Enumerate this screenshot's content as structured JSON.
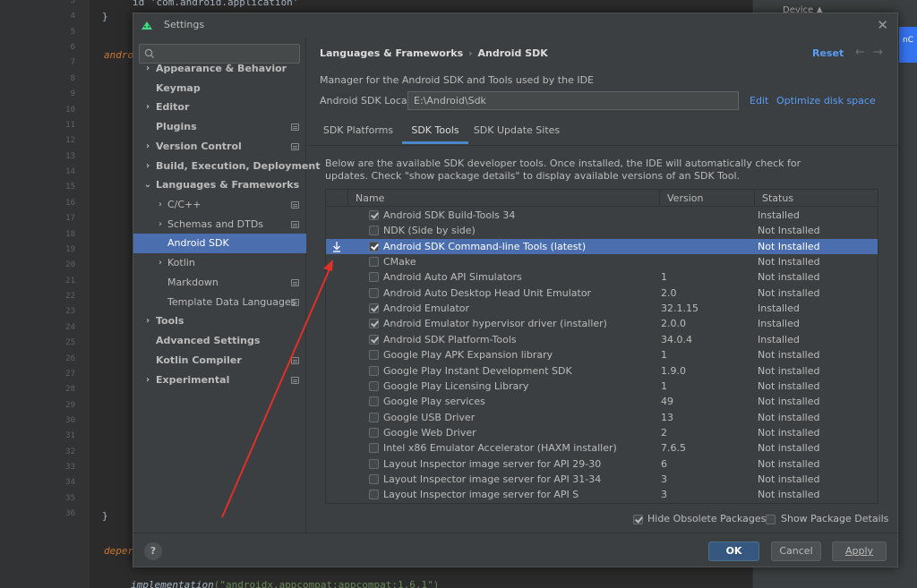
{
  "editor": {
    "line_numbers": [
      "3",
      "4",
      "5",
      "6",
      "7",
      "8",
      "9",
      "10",
      "11",
      "12",
      "13",
      "14",
      "15",
      "16",
      "17",
      "18",
      "19",
      "20",
      "21",
      "22",
      "23",
      "24",
      "25",
      "26",
      "27",
      "28",
      "29",
      "30",
      "31",
      "32",
      "33",
      "34",
      "35",
      "36"
    ],
    "top_code": "id 'com.android.application'",
    "fragment_android": "andro",
    "fragment_deps": "deper",
    "fragment_brace": "}",
    "bottom_code_fn": "implementation",
    "bottom_code_str": "(\"androidx.appcompat:appcompat:1.6.1\")"
  },
  "right_panel": {
    "device_label": "Device ▲",
    "edge_label": "nC"
  },
  "dialog": {
    "title": "Settings",
    "close_glyph": "✕"
  },
  "nav": {
    "search_placeholder": "",
    "items": [
      {
        "label": "Appearance & Behavior",
        "arrow": "›",
        "bold": true,
        "badge": false
      },
      {
        "label": "Keymap",
        "arrow": "",
        "bold": true,
        "badge": false
      },
      {
        "label": "Editor",
        "arrow": "›",
        "bold": true,
        "badge": false
      },
      {
        "label": "Plugins",
        "arrow": "",
        "bold": true,
        "badge": true
      },
      {
        "label": "Version Control",
        "arrow": "›",
        "bold": true,
        "badge": true
      },
      {
        "label": "Build, Execution, Deployment",
        "arrow": "›",
        "bold": true,
        "badge": false
      },
      {
        "label": "Languages & Frameworks",
        "arrow": "⌄",
        "bold": true,
        "badge": false
      },
      {
        "label": "C/C++",
        "arrow": "›",
        "bold": false,
        "badge": true
      },
      {
        "label": "Schemas and DTDs",
        "arrow": "›",
        "bold": false,
        "badge": true
      },
      {
        "label": "Android SDK",
        "arrow": "",
        "bold": false,
        "badge": false,
        "selected": true
      },
      {
        "label": "Kotlin",
        "arrow": "›",
        "bold": false,
        "badge": false
      },
      {
        "label": "Markdown",
        "arrow": "",
        "bold": false,
        "badge": true
      },
      {
        "label": "Template Data Languages",
        "arrow": "",
        "bold": false,
        "badge": true
      },
      {
        "label": "Tools",
        "arrow": "›",
        "bold": true,
        "badge": false
      },
      {
        "label": "Advanced Settings",
        "arrow": "",
        "bold": true,
        "badge": false
      },
      {
        "label": "Kotlin Compiler",
        "arrow": "",
        "bold": true,
        "badge": true
      },
      {
        "label": "Experimental",
        "arrow": "›",
        "bold": true,
        "badge": true
      }
    ]
  },
  "content": {
    "breadcrumb_parent": "Languages & Frameworks",
    "breadcrumb_sep": "›",
    "breadcrumb_current": "Android SDK",
    "reset_label": "Reset",
    "back_glyph": "←",
    "forward_glyph": "→",
    "description": "Manager for the Android SDK and Tools used by the IDE",
    "location_label": "Android SDK Location:",
    "location_value": "E:\\Android\\Sdk",
    "edit_label": "Edit",
    "optimize_label": "Optimize disk space",
    "tabs": [
      "SDK Platforms",
      "SDK Tools",
      "SDK Update Sites"
    ],
    "active_tab": "SDK Tools",
    "info_line1": "Below are the available SDK developer tools. Once installed, the IDE will automatically check for",
    "info_line2": "updates. Check \"show package details\" to display available versions of an SDK Tool."
  },
  "table": {
    "headers": {
      "name": "Name",
      "version": "Version",
      "status": "Status"
    },
    "rows": [
      {
        "name": "Android SDK Build-Tools 34",
        "version": "",
        "status": "Installed",
        "checked": true
      },
      {
        "name": "NDK (Side by side)",
        "version": "",
        "status": "Not Installed",
        "checked": false
      },
      {
        "name": "Android SDK Command-line Tools (latest)",
        "version": "",
        "status": "Not Installed",
        "checked": true,
        "selected": true,
        "download": true
      },
      {
        "name": "CMake",
        "version": "",
        "status": "Not Installed",
        "checked": false
      },
      {
        "name": "Android Auto API Simulators",
        "version": "1",
        "status": "Not installed",
        "checked": false
      },
      {
        "name": "Android Auto Desktop Head Unit Emulator",
        "version": "2.0",
        "status": "Not installed",
        "checked": false
      },
      {
        "name": "Android Emulator",
        "version": "32.1.15",
        "status": "Installed",
        "checked": true
      },
      {
        "name": "Android Emulator hypervisor driver (installer)",
        "version": "2.0.0",
        "status": "Installed",
        "checked": true
      },
      {
        "name": "Android SDK Platform-Tools",
        "version": "34.0.4",
        "status": "Installed",
        "checked": true
      },
      {
        "name": "Google Play APK Expansion library",
        "version": "1",
        "status": "Not installed",
        "checked": false
      },
      {
        "name": "Google Play Instant Development SDK",
        "version": "1.9.0",
        "status": "Not installed",
        "checked": false
      },
      {
        "name": "Google Play Licensing Library",
        "version": "1",
        "status": "Not installed",
        "checked": false
      },
      {
        "name": "Google Play services",
        "version": "49",
        "status": "Not installed",
        "checked": false
      },
      {
        "name": "Google USB Driver",
        "version": "13",
        "status": "Not installed",
        "checked": false
      },
      {
        "name": "Google Web Driver",
        "version": "2",
        "status": "Not installed",
        "checked": false
      },
      {
        "name": "Intel x86 Emulator Accelerator (HAXM installer)",
        "version": "7.6.5",
        "status": "Not installed",
        "checked": false
      },
      {
        "name": "Layout Inspector image server for API 29-30",
        "version": "6",
        "status": "Not installed",
        "checked": false
      },
      {
        "name": "Layout Inspector image server for API 31-34",
        "version": "3",
        "status": "Not installed",
        "checked": false
      },
      {
        "name": "Layout Inspector image server for API S",
        "version": "3",
        "status": "Not installed",
        "checked": false
      }
    ]
  },
  "options": {
    "hide_obsolete_label": "Hide Obsolete Packages",
    "hide_obsolete_checked": true,
    "show_details_label": "Show Package Details",
    "show_details_checked": false
  },
  "footer": {
    "help_glyph": "?",
    "ok_label": "OK",
    "cancel_label": "Cancel",
    "apply_label": "Apply"
  },
  "colors": {
    "accent": "#4b6eaf",
    "link": "#589df6",
    "annotation_arrow": "#e0302a"
  }
}
